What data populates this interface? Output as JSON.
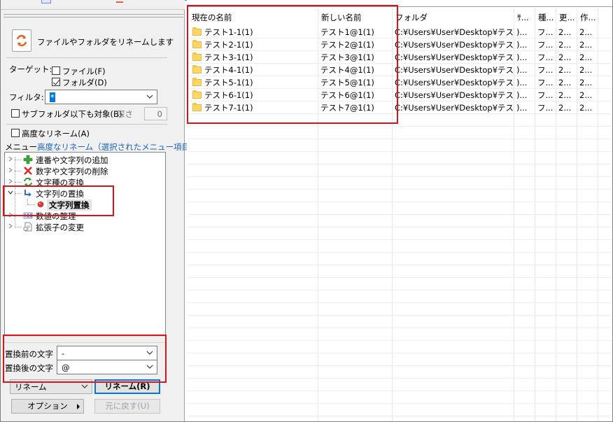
{
  "left": {
    "header_text": "ファイルやフォルダをリネームします",
    "target_label": "ターゲット:",
    "file_checkbox": {
      "label": "ファイル(F)",
      "checked": false
    },
    "folder_checkbox": {
      "label": "フォルダ(D)",
      "checked": true
    },
    "filter_label": "フィルタ:",
    "filter_value": "*",
    "subfolder_checkbox": {
      "label": "サブフォルダ以下も対象(B)",
      "checked": false
    },
    "depth_label": "深さ",
    "depth_value": "0",
    "advanced_checkbox": {
      "label": "高度なリネーム(A)",
      "checked": false
    },
    "menu_label": "メニュー",
    "menu_selected": "高度なリネーム（選択されたメニュー項目）",
    "tree": [
      {
        "label": "連番や文字列の追加",
        "icon": "plus-icon"
      },
      {
        "label": "数字や文字列の削除",
        "icon": "cross-icon"
      },
      {
        "label": "文字種の変換",
        "icon": "refresh-icon"
      },
      {
        "label": "文字列の置換",
        "icon": "replace-arrow-icon",
        "expanded": true
      },
      {
        "label": "文字列置換",
        "icon": "red-dot-icon",
        "selected": true
      },
      {
        "label": "数値の整理",
        "icon": "number-icon"
      },
      {
        "label": "拡張子の変更",
        "icon": "document-icon"
      }
    ],
    "replace_before_label": "置換前の文字",
    "replace_before_value": "-",
    "replace_after_label": "置換後の文字",
    "replace_after_value": "@",
    "mode_value": "リネーム",
    "rename_button": "リネーム(R)",
    "options_button": "オプション",
    "undo_button": "元に戻す(U)"
  },
  "table": {
    "columns": [
      "現在の名前",
      "新しい名前",
      "フォルダ",
      "ｻ...",
      "種...",
      "更...",
      "作..."
    ],
    "rows": [
      {
        "current": "テスト1-1(1)",
        "new": "テスト1@1(1)",
        "folder": "C:¥Users¥User¥Desktop¥テス...",
        "size": ")...",
        "type": "フ...",
        "modified": "2...",
        "created": "2..."
      },
      {
        "current": "テスト2-1(1)",
        "new": "テスト2@1(1)",
        "folder": "C:¥Users¥User¥Desktop¥テス...",
        "size": ")...",
        "type": "フ...",
        "modified": "2...",
        "created": "2..."
      },
      {
        "current": "テスト3-1(1)",
        "new": "テスト3@1(1)",
        "folder": "C:¥Users¥User¥Desktop¥テス...",
        "size": ")...",
        "type": "フ...",
        "modified": "2...",
        "created": "2..."
      },
      {
        "current": "テスト4-1(1)",
        "new": "テスト4@1(1)",
        "folder": "C:¥Users¥User¥Desktop¥テス...",
        "size": ")...",
        "type": "フ...",
        "modified": "2...",
        "created": "2..."
      },
      {
        "current": "テスト5-1(1)",
        "new": "テスト5@1(1)",
        "folder": "C:¥Users¥User¥Desktop¥テス...",
        "size": ")...",
        "type": "フ...",
        "modified": "2...",
        "created": "2..."
      },
      {
        "current": "テスト6-1(1)",
        "new": "テスト6@1(1)",
        "folder": "C:¥Users¥User¥Desktop¥テス...",
        "size": ")...",
        "type": "フ...",
        "modified": "2...",
        "created": "2..."
      },
      {
        "current": "テスト7-1(1)",
        "new": "テスト7@1(1)",
        "folder": "C:¥Users¥User¥Desktop¥テス...",
        "size": ")...",
        "type": "フ...",
        "modified": "2...",
        "created": "2..."
      }
    ]
  },
  "colors": {
    "highlight_box": "#d9141c",
    "selection": "#0078d7",
    "folder": "#ffd75e"
  }
}
